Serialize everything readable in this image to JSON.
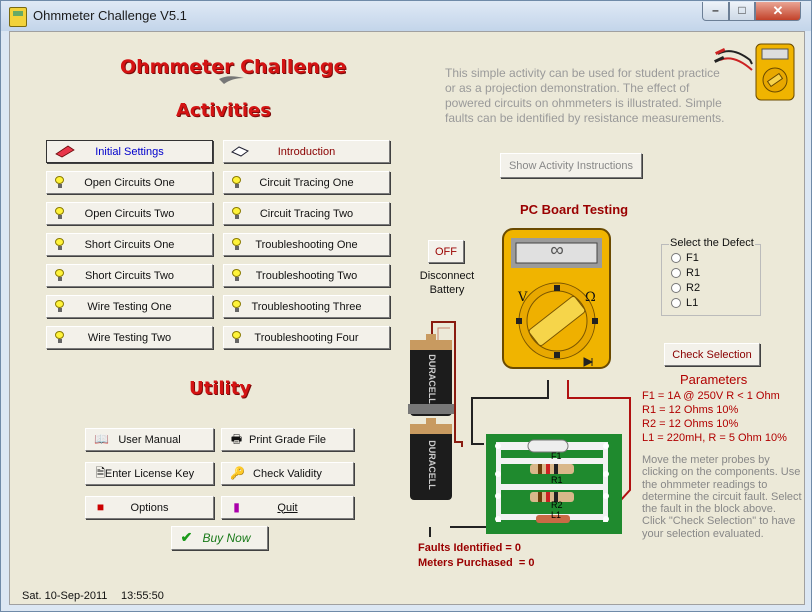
{
  "window": {
    "title": "Ohmmeter Challenge V5.1"
  },
  "app_title": "Ohmmeter Challenge",
  "activities": {
    "heading": "Activities",
    "left": [
      "Initial Settings",
      "Open Circuits One",
      "Open Circuits Two",
      "Short Circuits One",
      "Short Circuits Two",
      "Wire Testing One",
      "Wire Testing Two"
    ],
    "right": [
      "Introduction",
      "Circuit Tracing One",
      "Circuit Tracing Two",
      "Troubleshooting One",
      "Troubleshooting Two",
      "Troubleshooting Three",
      "Troubleshooting Four"
    ]
  },
  "utility": {
    "heading": "Utility",
    "user_manual": "User Manual",
    "print_grade": "Print Grade File",
    "license_key": "Enter License Key",
    "check_validity": "Check Validity",
    "options": "Options",
    "quit": "Quit",
    "buy_now": "Buy Now"
  },
  "description": "This simple activity can be used for student practice or as a projection demonstration. The effect of powered circuits on ohmmeters is illustrated. Simple faults can be identified by resistance measurements.",
  "show_instructions": "Show Activity Instructions",
  "pcb": {
    "title": "PC Board Testing",
    "battery_toggle": "OFF",
    "disconnect_label": "Disconnect Battery",
    "meter_display": "∞",
    "meter_v": "V",
    "meter_omega": "Ω",
    "battery_brand": "DURACELL",
    "labels": {
      "f1": "F1",
      "r1": "R1",
      "r2": "R2",
      "l1": "L1"
    }
  },
  "defect": {
    "legend": "Select the Defect",
    "options": [
      "F1",
      "R1",
      "R2",
      "L1"
    ],
    "check_button": "Check Selection"
  },
  "parameters": {
    "heading": "Parameters",
    "lines": [
      "F1 = 1A @ 250V  R < 1 Ohm",
      "R1 = 12 Ohms  10%",
      "R2 = 12 Ohms  10%",
      "L1 = 220mH,   R = 5 Ohm 10%"
    ]
  },
  "instructions_text": "Move the meter probes by clicking on the components. Use the ohmmeter readings to determine the circuit fault. Select the fault in the block above. Click \"Check Selection\" to have your selection evaluated.",
  "counters": {
    "faults": "Faults Identified = 0",
    "meters": "Meters Purchased  = 0"
  },
  "status": {
    "date": "Sat.  10-Sep-2011",
    "time": "13:55:50"
  },
  "colors": {
    "heading_red": "#d41313",
    "meter_yellow": "#f0b400",
    "board_green": "#1f8a2e"
  }
}
